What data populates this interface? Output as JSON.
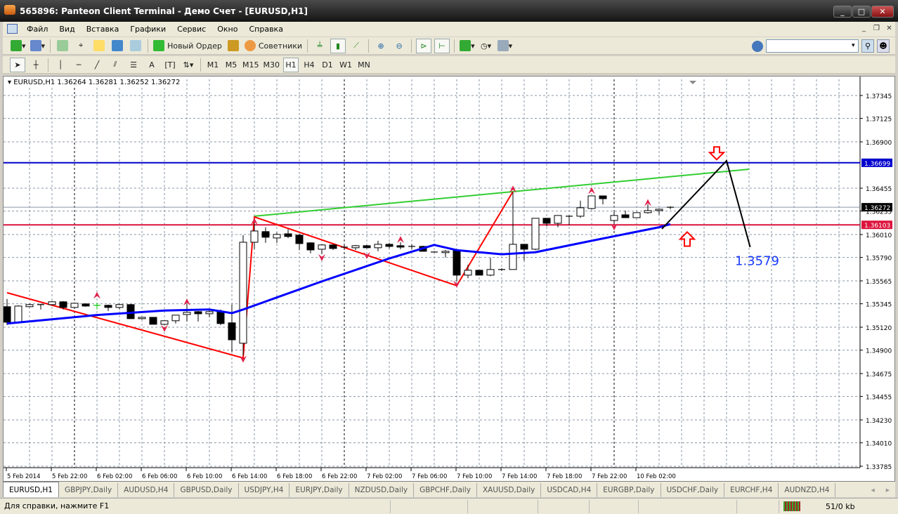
{
  "window": {
    "title": "565896: Panteon Client Terminal - Демо Счет - [EURUSD,H1]",
    "controls": [
      "_",
      "□",
      "✕"
    ]
  },
  "menu": [
    "Файл",
    "Вид",
    "Вставка",
    "Графики",
    "Сервис",
    "Окно",
    "Справка"
  ],
  "toolbar1": {
    "new_order": "Новый Ордер",
    "advisors": "Советники",
    "search_placeholder": ""
  },
  "toolbar2": {
    "timeframes": [
      "M1",
      "M5",
      "M15",
      "M30",
      "H1",
      "H4",
      "D1",
      "W1",
      "MN"
    ],
    "active": "H1"
  },
  "chart_info": "EURUSD,H1  1.36264 1.36281 1.36252 1.36272",
  "colors": {
    "blue_level": "#0000cc",
    "red_level": "#dc143c",
    "zigzag": "#ff0000",
    "trend": "#32cd32",
    "ma": "#0000ff",
    "forecast": "#000000"
  },
  "chart_data": {
    "type": "candlestick",
    "symbol": "EURUSD",
    "timeframe": "H1",
    "ylim": [
      1.33785,
      1.37345
    ],
    "yticks": [
      "1.37345",
      "1.37125",
      "1.36900",
      "1.36455",
      "1.36235",
      "1.36010",
      "1.35790",
      "1.35565",
      "1.35345",
      "1.35120",
      "1.34900",
      "1.34675",
      "1.34455",
      "1.34230",
      "1.34010",
      "1.33785"
    ],
    "xticks": [
      "5 Feb 2014",
      "5 Feb 22:00",
      "6 Feb 02:00",
      "6 Feb 06:00",
      "6 Feb 10:00",
      "6 Feb 14:00",
      "6 Feb 18:00",
      "6 Feb 22:00",
      "7 Feb 02:00",
      "7 Feb 06:00",
      "7 Feb 10:00",
      "7 Feb 14:00",
      "7 Feb 18:00",
      "7 Feb 22:00",
      "10 Feb 02:00"
    ],
    "xtick_every_bars": 4,
    "day_separators_bars": [
      6,
      30,
      54
    ],
    "candles": [
      [
        1.35317,
        1.35391,
        1.35141,
        1.35168
      ],
      [
        1.35168,
        1.3533,
        1.35155,
        1.35323
      ],
      [
        1.35317,
        1.35344,
        1.3531,
        1.35337
      ],
      [
        1.35337,
        1.35344,
        1.3529,
        1.35337
      ],
      [
        1.35337,
        1.35371,
        1.3533,
        1.35364
      ],
      [
        1.35364,
        1.35371,
        1.3529,
        1.3531
      ],
      [
        1.3531,
        1.35357,
        1.35303,
        1.3535
      ],
      [
        1.35344,
        1.3535,
        1.35317,
        1.35323
      ],
      [
        1.3533,
        1.35357,
        1.3529,
        1.3533
      ],
      [
        1.3533,
        1.35337,
        1.35276,
        1.3531
      ],
      [
        1.3531,
        1.35344,
        1.3529,
        1.35337
      ],
      [
        1.35337,
        1.35344,
        1.35202,
        1.35202
      ],
      [
        1.35202,
        1.35215,
        1.35195,
        1.35215
      ],
      [
        1.35215,
        1.35215,
        1.35148,
        1.35148
      ],
      [
        1.35148,
        1.35182,
        1.35141,
        1.35182
      ],
      [
        1.35182,
        1.35236,
        1.35155,
        1.35236
      ],
      [
        1.35242,
        1.35344,
        1.35175,
        1.35263
      ],
      [
        1.35269,
        1.35276,
        1.35175,
        1.35249
      ],
      [
        1.35249,
        1.3529,
        1.35215,
        1.35269
      ],
      [
        1.35269,
        1.3529,
        1.35141,
        1.35155
      ],
      [
        1.35162,
        1.35337,
        1.34878,
        1.34999
      ],
      [
        1.34966,
        1.36004,
        1.3485,
        1.35936
      ],
      [
        1.35936,
        1.3612,
        1.3587,
        1.36044
      ],
      [
        1.36038,
        1.3608,
        1.3593,
        1.35984
      ],
      [
        1.35977,
        1.3603,
        1.3593,
        1.36011
      ],
      [
        1.36017,
        1.3606,
        1.35975,
        1.35991
      ],
      [
        1.36004,
        1.36017,
        1.3586,
        1.35923
      ],
      [
        1.3593,
        1.35936,
        1.3583,
        1.35862
      ],
      [
        1.35869,
        1.35916,
        1.3582,
        1.3591
      ],
      [
        1.3591,
        1.35916,
        1.35862,
        1.35876
      ],
      [
        1.35889,
        1.35903,
        1.35862,
        1.35889
      ],
      [
        1.35883,
        1.3591,
        1.35862,
        1.35903
      ],
      [
        1.35903,
        1.3591,
        1.35876,
        1.35883
      ],
      [
        1.35883,
        1.3595,
        1.3585,
        1.35916
      ],
      [
        1.35916,
        1.3593,
        1.35876,
        1.35896
      ],
      [
        1.35903,
        1.35936,
        1.35869,
        1.35889
      ],
      [
        1.35896,
        1.35916,
        1.35869,
        1.35896
      ],
      [
        1.35896,
        1.35903,
        1.35849,
        1.35849
      ],
      [
        1.35842,
        1.35849,
        1.35842,
        1.35842
      ],
      [
        1.35836,
        1.35862,
        1.3579,
        1.35849
      ],
      [
        1.35856,
        1.35869,
        1.3556,
        1.3562
      ],
      [
        1.3562,
        1.3572,
        1.3559,
        1.35667
      ],
      [
        1.35667,
        1.35667,
        1.3562,
        1.3562
      ],
      [
        1.3562,
        1.35785,
        1.3561,
        1.35674
      ],
      [
        1.35674,
        1.35687,
        1.3566,
        1.35674
      ],
      [
        1.35674,
        1.36415,
        1.35674,
        1.35916
      ],
      [
        1.35916,
        1.35916,
        1.3576,
        1.35869
      ],
      [
        1.35869,
        1.36166,
        1.3586,
        1.36166
      ],
      [
        1.36166,
        1.36166,
        1.3609,
        1.36118
      ],
      [
        1.36118,
        1.36193,
        1.3608,
        1.36193
      ],
      [
        1.36186,
        1.36193,
        1.361,
        1.36186
      ],
      [
        1.36186,
        1.36335,
        1.36172,
        1.36267
      ],
      [
        1.3626,
        1.36381,
        1.3625,
        1.36381
      ],
      [
        1.36381,
        1.36381,
        1.363,
        1.36354
      ],
      [
        1.36145,
        1.3624,
        1.3611,
        1.36193
      ],
      [
        1.36199,
        1.3624,
        1.36172,
        1.36172
      ],
      [
        1.36172,
        1.3622,
        1.36172,
        1.3622
      ],
      [
        1.3622,
        1.363,
        1.3621,
        1.3624
      ],
      [
        1.3624,
        1.3626,
        1.362,
        1.36253
      ],
      [
        1.36264,
        1.36281,
        1.36252,
        1.36272
      ]
    ],
    "moving_average": [
      [
        0,
        1.35155
      ],
      [
        8,
        1.35237
      ],
      [
        14,
        1.3528
      ],
      [
        18,
        1.3529
      ],
      [
        20,
        1.35255
      ],
      [
        21,
        1.3529
      ],
      [
        28,
        1.3556
      ],
      [
        34,
        1.3578
      ],
      [
        38,
        1.3591
      ],
      [
        40,
        1.3586
      ],
      [
        44,
        1.3582
      ],
      [
        47,
        1.3584
      ],
      [
        52,
        1.3595
      ],
      [
        58,
        1.3608
      ],
      [
        59,
        1.3611
      ]
    ],
    "zigzag": [
      [
        0,
        1.35451
      ],
      [
        21,
        1.34824
      ],
      [
        22,
        1.36179
      ],
      [
        40,
        1.35519
      ],
      [
        45,
        1.36422
      ]
    ],
    "trendline": [
      [
        22,
        1.36186
      ],
      [
        66,
        1.36637
      ]
    ],
    "forecast": [
      [
        58.25,
        1.36064
      ],
      [
        64,
        1.36718
      ],
      [
        66.1,
        1.35889
      ]
    ],
    "fractals_up": [
      [
        8,
        1.3542
      ],
      [
        16,
        1.35355
      ],
      [
        22,
        1.3613
      ],
      [
        35,
        1.35955
      ],
      [
        45,
        1.3644
      ],
      [
        52,
        1.36425
      ],
      [
        57,
        1.3631
      ]
    ],
    "fractals_down": [
      [
        14,
        1.35115
      ],
      [
        21,
        1.3482
      ],
      [
        28,
        1.35795
      ],
      [
        32,
        1.35815
      ],
      [
        40,
        1.3554
      ],
      [
        54,
        1.3609
      ]
    ],
    "hlines": [
      {
        "price": 1.36699,
        "label": "1.36699",
        "color": "#0000cc"
      },
      {
        "price": 1.36103,
        "label": "1.36103",
        "color": "#dc143c"
      },
      {
        "price": 1.36272,
        "label": "1.36272",
        "color": "#000000"
      }
    ],
    "arrow_down": [
      63,
      1.3677
    ],
    "arrow_up": [
      60,
      1.3598
    ],
    "annotation": {
      "text": "1.3579",
      "bar": 65.5,
      "price": 1.3577
    }
  },
  "tabs": [
    "EURUSD,H1",
    "GBPJPY,Daily",
    "AUDUSD,H4",
    "GBPUSD,Daily",
    "USDJPY,H4",
    "EURJPY,Daily",
    "NZDUSD,Daily",
    "GBPCHF,Daily",
    "XAUUSD,Daily",
    "USDCAD,H4",
    "EURGBP,Daily",
    "USDCHF,Daily",
    "EURCHF,H4",
    "AUDNZD,H4"
  ],
  "tab_nav": [
    "◂",
    "▸"
  ],
  "status": {
    "help": "Для справки, нажмите F1",
    "traffic": "51/0 kb"
  }
}
